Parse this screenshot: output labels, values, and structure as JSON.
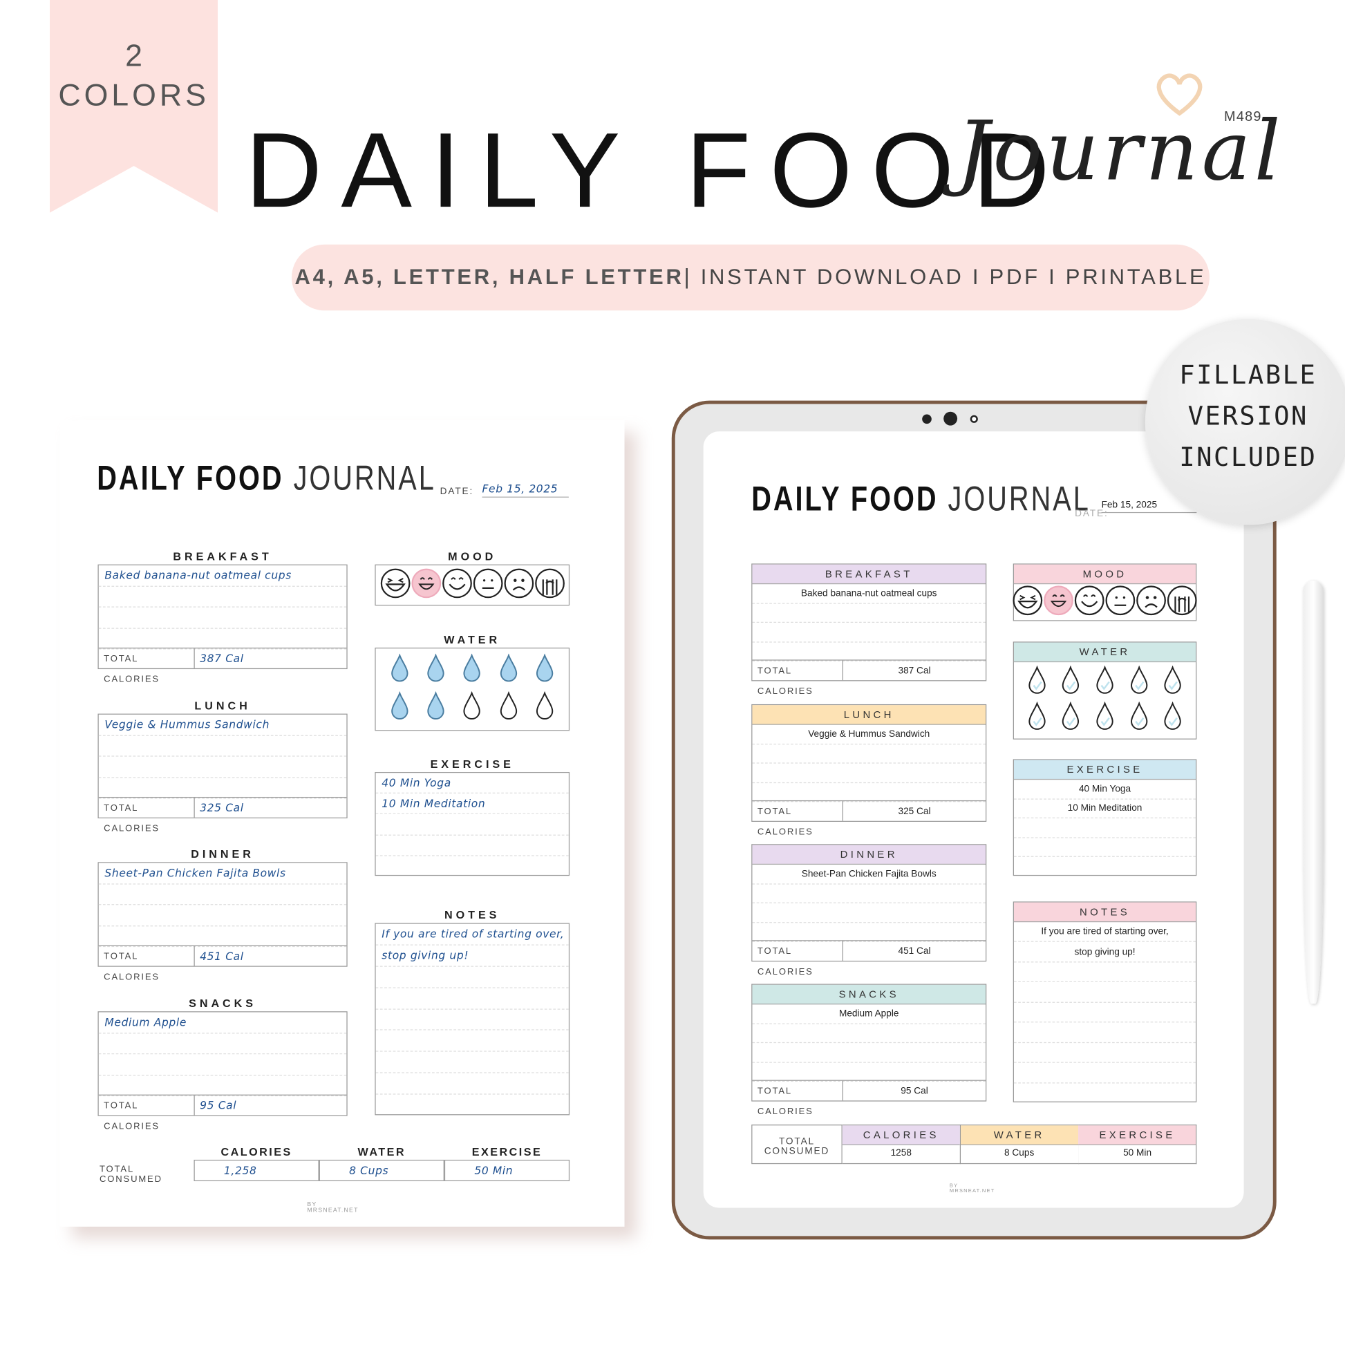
{
  "banner": {
    "count": "2",
    "label": "COLORS",
    "title": "DAILY FOOD",
    "script_title": "Journal",
    "code": "M489",
    "formats": "A4, A5, LETTER, HALF LETTER",
    "details": "| INSTANT DOWNLOAD I PDF I PRINTABLE"
  },
  "badge": {
    "lines": [
      "FILLABLE",
      "VERSION",
      "INCLUDED"
    ]
  },
  "journal": {
    "title_bold": "DAILY FOOD",
    "title_light": "JOURNAL",
    "date_label": "DATE:",
    "date": "Feb 15, 2025",
    "total_label": "TOTAL CALORIES",
    "meals": [
      {
        "name": "BREAKFAST",
        "entry": "Baked banana-nut oatmeal cups",
        "calories": "387 Cal",
        "color": "#e8daef"
      },
      {
        "name": "LUNCH",
        "entry": "Veggie & Hummus Sandwich",
        "calories": "325 Cal",
        "color": "#fde2b4"
      },
      {
        "name": "DINNER",
        "entry": "Sheet-Pan Chicken Fajita Bowls",
        "calories": "451 Cal",
        "color": "#e8daef"
      },
      {
        "name": "SNACKS",
        "entry": "Medium Apple",
        "calories": "95 Cal",
        "color": "#cfe8e6"
      }
    ],
    "mood": {
      "label": "MOOD",
      "faces": [
        "laughing",
        "grinning",
        "smiling",
        "neutral",
        "sad",
        "crying"
      ],
      "selected": 1,
      "color": "#f9d5dc",
      "highlight": "#f6c5cf"
    },
    "water": {
      "label": "WATER",
      "total": 10,
      "filled": 7,
      "color": "#cfe8e6",
      "fill": "#a9d4ef"
    },
    "exercise": {
      "label": "EXERCISE",
      "entries": [
        "40 Min Yoga",
        "10 Min Meditation"
      ],
      "color": "#cfe8f2"
    },
    "notes": {
      "label": "NOTES",
      "entries": [
        "If you are tired of starting over,",
        "stop giving up!"
      ],
      "color": "#f9d5dc"
    },
    "totals": {
      "label": "TOTAL CONSUMED",
      "label_l1": "TOTAL",
      "label_l2": "CONSUMED",
      "columns": [
        {
          "name": "CALORIES",
          "value": "1,258",
          "tablet_value": "1258",
          "color": "#e8daef"
        },
        {
          "name": "WATER",
          "value": "8 Cups",
          "tablet_value": "8 Cups",
          "color": "#fde2b4"
        },
        {
          "name": "EXERCISE",
          "value": "50 Min",
          "tablet_value": "50 Min",
          "color": "#f9d5dc"
        }
      ]
    },
    "footer": "BY MRSNEAT.NET"
  },
  "colors": {
    "ribbon": "#fde2df",
    "pill": "#fce3e0",
    "tablet_frame": "#7b5a44",
    "ink": "#1e4f8f"
  }
}
